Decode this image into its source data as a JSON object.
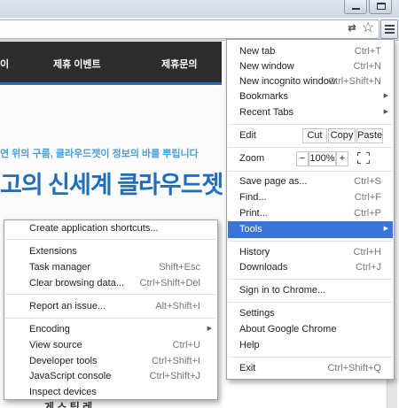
{
  "toolbar": {
    "translate_icon": "translate-icon",
    "star_icon": "star-icon",
    "menu_icon": "hamburger-icon",
    "translate_glyph": "⇄",
    "star_glyph": "☆"
  },
  "page": {
    "nav_items": [
      "이",
      "제휴 이벤트",
      "제휴문의"
    ],
    "subline": "연 위의 구름, 클라우드젯이 정보의 바를 뿌립니다",
    "headline": "고의 신세계 클라우드젯",
    "bottom_text": "게 스 팀 레"
  },
  "main_menu": {
    "new_tab": {
      "label": "New tab",
      "shortcut": "Ctrl+T"
    },
    "new_window": {
      "label": "New window",
      "shortcut": "Ctrl+N"
    },
    "new_incognito": {
      "label": "New incognito window",
      "shortcut": "Ctrl+Shift+N"
    },
    "bookmarks": {
      "label": "Bookmarks"
    },
    "recent_tabs": {
      "label": "Recent Tabs"
    },
    "edit": {
      "label": "Edit",
      "cut": "Cut",
      "copy": "Copy",
      "paste": "Paste"
    },
    "zoom": {
      "label": "Zoom",
      "minus": "−",
      "value": "100%",
      "plus": "+"
    },
    "save_page": {
      "label": "Save page as...",
      "shortcut": "Ctrl+S"
    },
    "find": {
      "label": "Find...",
      "shortcut": "Ctrl+F"
    },
    "print": {
      "label": "Print...",
      "shortcut": "Ctrl+P"
    },
    "tools": {
      "label": "Tools"
    },
    "history": {
      "label": "History",
      "shortcut": "Ctrl+H"
    },
    "downloads": {
      "label": "Downloads",
      "shortcut": "Ctrl+J"
    },
    "sign_in": {
      "label": "Sign in to Chrome..."
    },
    "settings": {
      "label": "Settings"
    },
    "about": {
      "label": "About Google Chrome"
    },
    "help": {
      "label": "Help"
    },
    "exit": {
      "label": "Exit",
      "shortcut": "Ctrl+Shift+Q"
    }
  },
  "tools_menu": {
    "create_shortcuts": {
      "label": "Create application shortcuts..."
    },
    "extensions": {
      "label": "Extensions"
    },
    "task_manager": {
      "label": "Task manager",
      "shortcut": "Shift+Esc"
    },
    "clear_data": {
      "label": "Clear browsing data...",
      "shortcut": "Ctrl+Shift+Del"
    },
    "report_issue": {
      "label": "Report an issue...",
      "shortcut": "Alt+Shift+I"
    },
    "encoding": {
      "label": "Encoding"
    },
    "view_source": {
      "label": "View source",
      "shortcut": "Ctrl+U"
    },
    "dev_tools": {
      "label": "Developer tools",
      "shortcut": "Ctrl+Shift+I"
    },
    "js_console": {
      "label": "JavaScript console",
      "shortcut": "Ctrl+Shift+J"
    },
    "inspect_devices": {
      "label": "Inspect devices"
    }
  },
  "colors": {
    "highlight": "#3875d7",
    "nav_bg": "#2d2d2d",
    "headline": "#1f6fb8"
  }
}
